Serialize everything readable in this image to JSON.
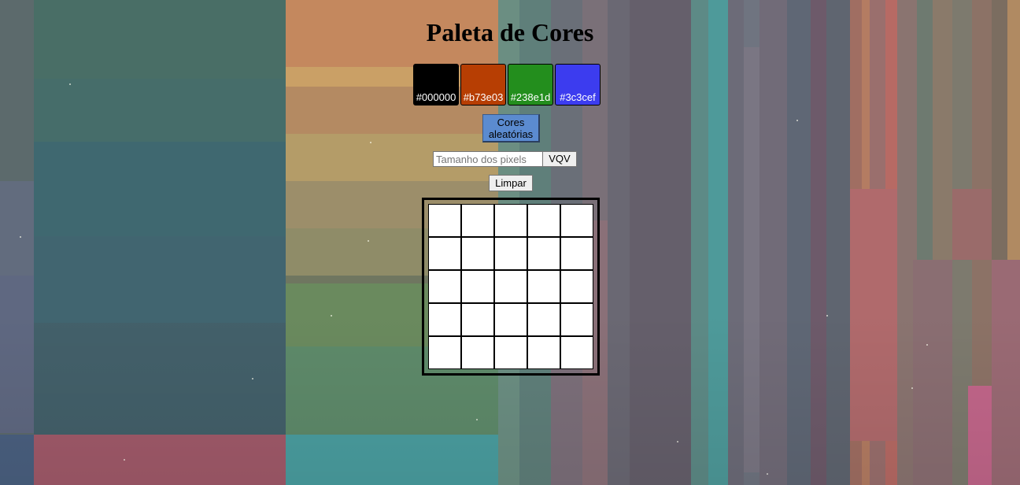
{
  "page": {
    "title": "Paleta de Cores"
  },
  "palette": {
    "colors": [
      {
        "hex": "#000000",
        "label": "#000000"
      },
      {
        "hex": "#b73e03",
        "label": "#b73e03"
      },
      {
        "hex": "#238e1d",
        "label": "#238e1d"
      },
      {
        "hex": "#3c3cef",
        "label": "#3c3cef"
      }
    ]
  },
  "controls": {
    "random_colors_label": "Cores aleatórias",
    "board_size_placeholder": "Tamanho dos pixels",
    "board_size_value": "",
    "generate_board_label": "VQV",
    "clear_label": "Limpar"
  },
  "board": {
    "rows": 5,
    "columns": 5,
    "pixel_color": "#ffffff"
  }
}
